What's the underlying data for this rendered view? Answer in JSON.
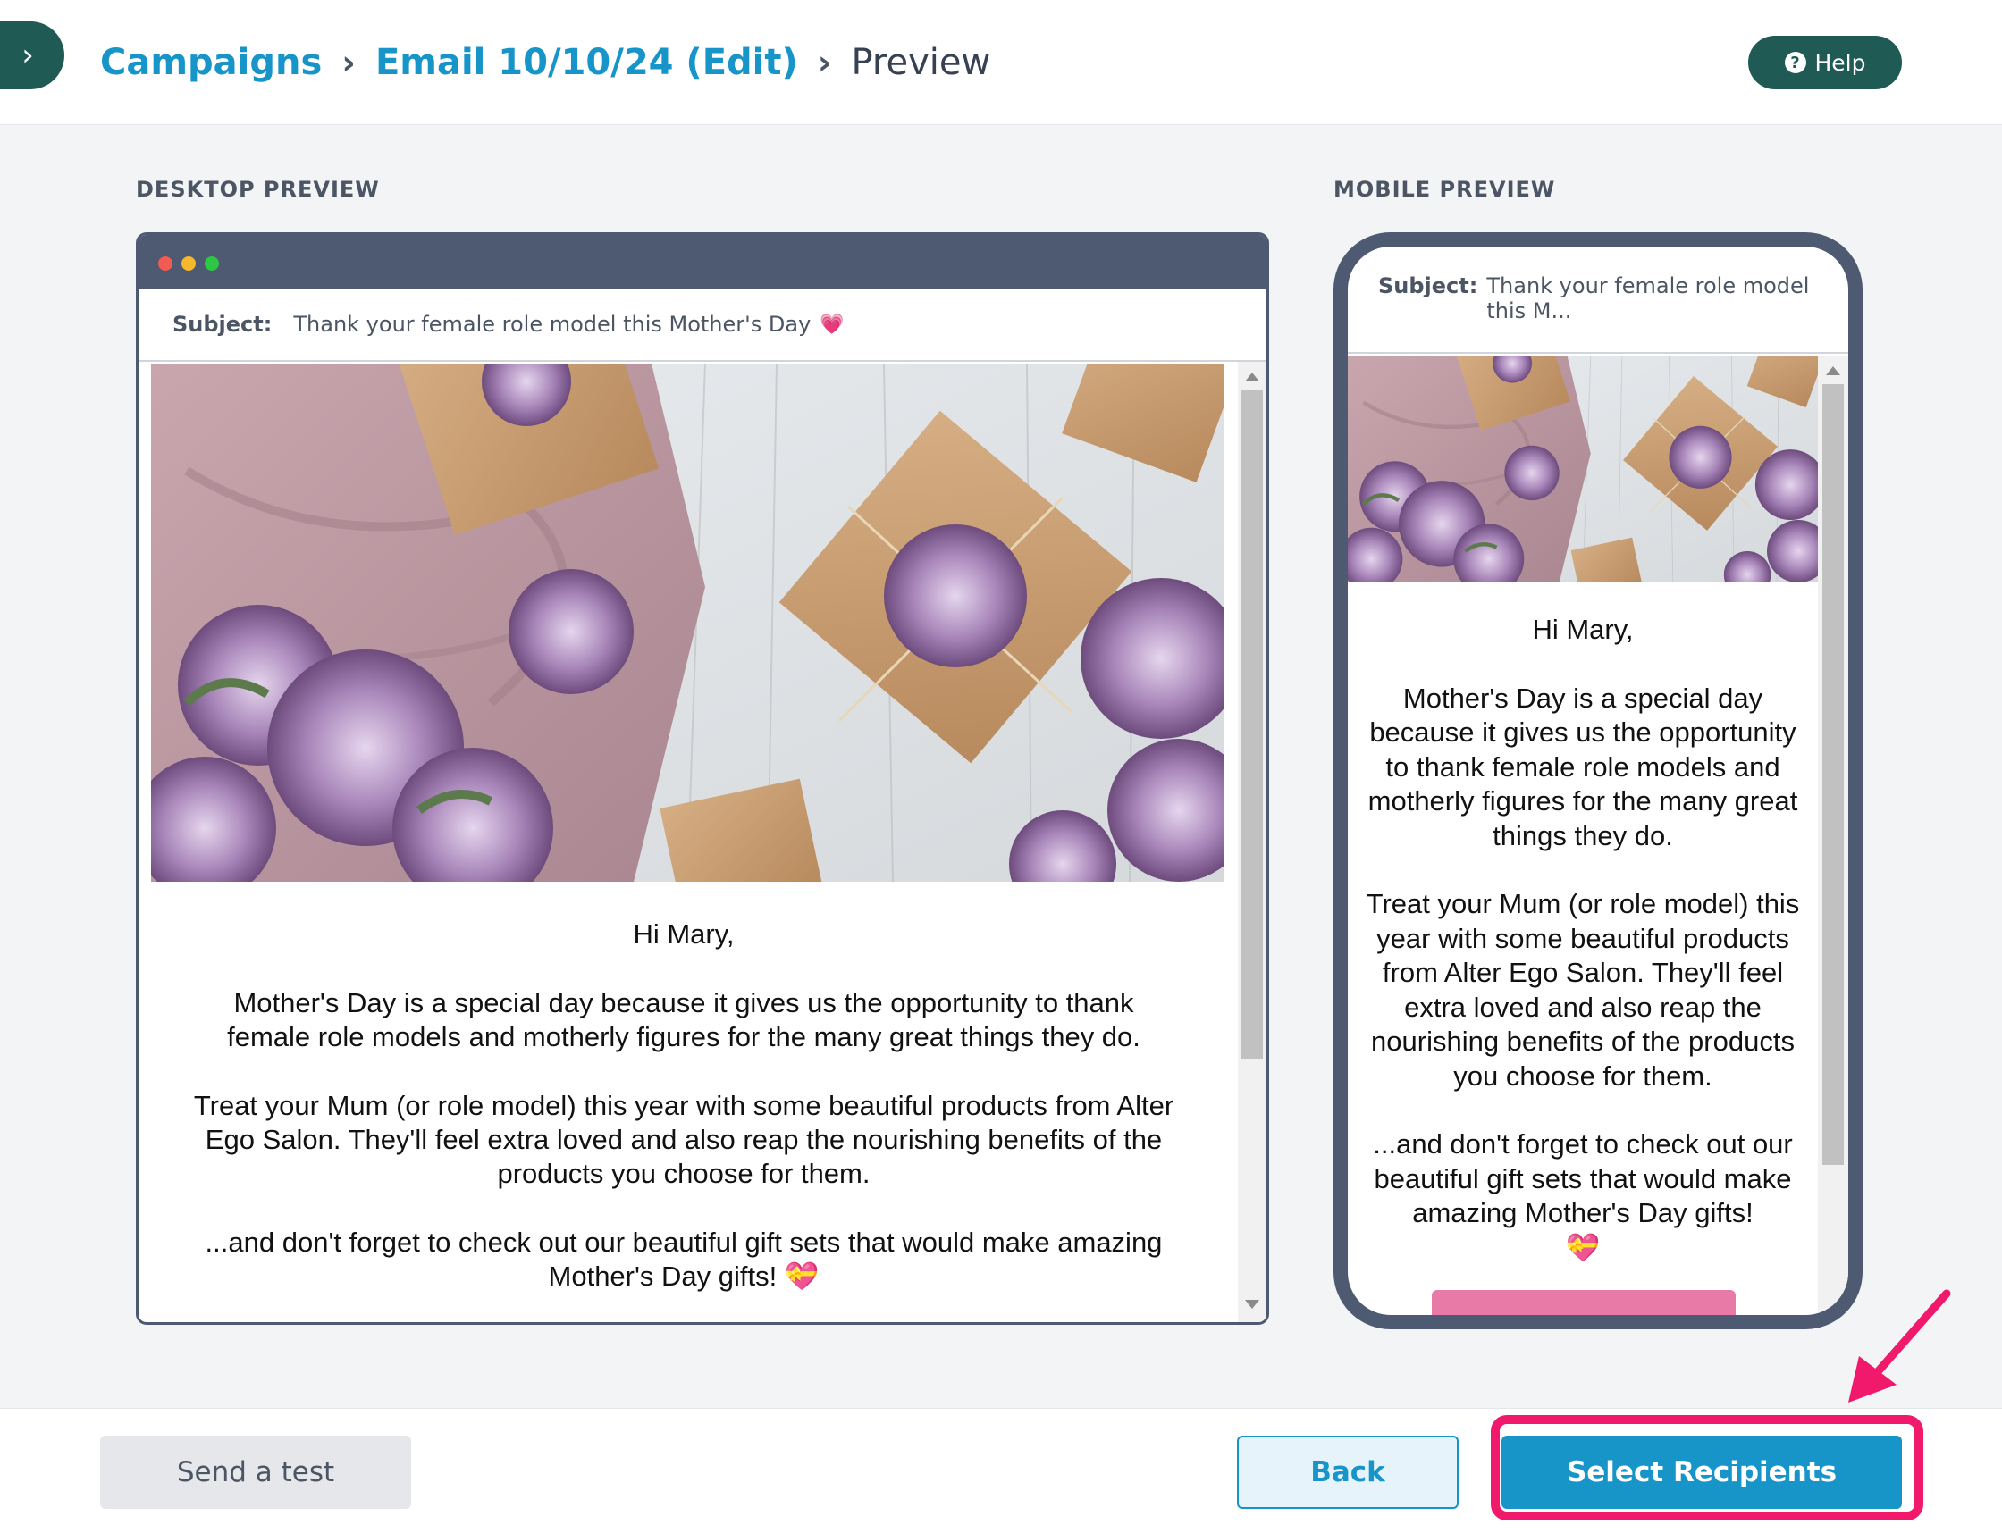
{
  "header": {
    "breadcrumb": {
      "campaigns": "Campaigns",
      "email": "Email 10/10/24 (Edit)",
      "current": "Preview"
    },
    "help_label": "Help"
  },
  "desktop_preview": {
    "label": "DESKTOP PREVIEW",
    "subject_label": "Subject:",
    "subject_text": "Thank your female role model this Mother's Day",
    "subject_emoji": "💗"
  },
  "mobile_preview": {
    "label": "MOBILE PREVIEW",
    "subject_label": "Subject:",
    "subject_text": "Thank your female role model this M..."
  },
  "email": {
    "greeting": "Hi Mary,",
    "paragraph1": "Mother's Day is a special day because it gives us the opportunity to thank female role models and motherly figures for the many great things they do.",
    "paragraph2": "Treat your Mum (or role model) this year with some beautiful products from Alter Ego Salon. They'll feel extra loved and also reap the nourishing benefits of the products you choose for them.",
    "paragraph3": "...and don't forget to check out our beautiful gift sets that would make amazing Mother's Day gifts!",
    "emoji": "💝"
  },
  "footer": {
    "send_test": "Send a test",
    "back": "Back",
    "select_recipients": "Select Recipients"
  },
  "colors": {
    "brand_teal": "#1f5a55",
    "link_blue": "#1795c9",
    "frame_slate": "#4d5a71",
    "annotation_pink": "#f0196b"
  },
  "icons": {
    "sidebar_toggle": "chevron-right-icon",
    "help": "question-circle-icon"
  }
}
